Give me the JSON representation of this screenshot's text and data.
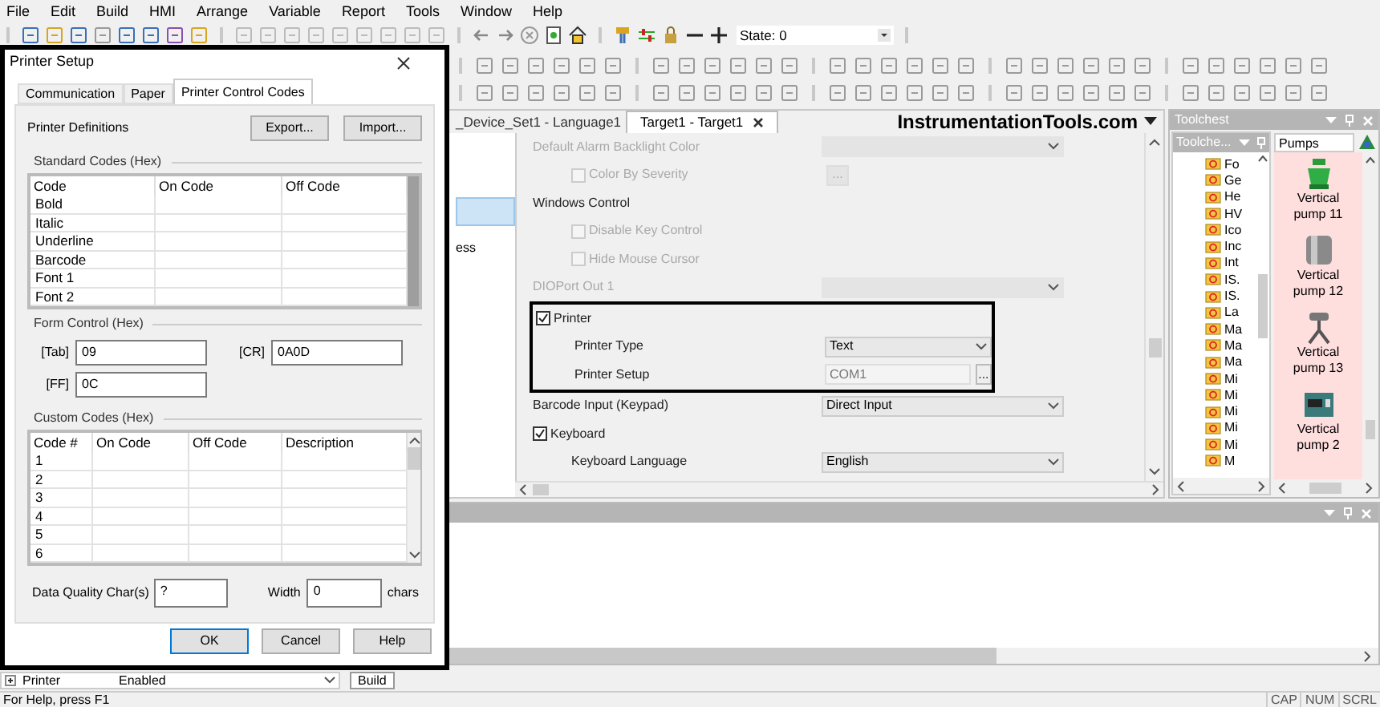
{
  "menu": [
    "File",
    "Edit",
    "Build",
    "HMI",
    "Arrange",
    "Variable",
    "Report",
    "Tools",
    "Window",
    "Help"
  ],
  "toolbar": {
    "state_label": "State: 0"
  },
  "document_tabs": [
    {
      "label": "_Device_Set1 - Language1",
      "selected": false
    },
    {
      "label": "Target1 - Target1",
      "selected": true
    }
  ],
  "site_label": "InstrumentationTools.com",
  "left_pane": {
    "text": "ess"
  },
  "properties": [
    {
      "kind": "dropdown",
      "label": "Default Alarm Backlight Color",
      "disabled": true,
      "indent": false
    },
    {
      "kind": "checkbox",
      "label": "Color By Severity",
      "checked": false,
      "disabled": true,
      "indent": true,
      "browse": "..."
    },
    {
      "kind": "heading",
      "label": "Windows Control"
    },
    {
      "kind": "checkbox",
      "label": "Disable Key Control",
      "checked": false,
      "disabled": true,
      "indent": true
    },
    {
      "kind": "checkbox",
      "label": "Hide Mouse Cursor",
      "checked": false,
      "disabled": true,
      "indent": true
    },
    {
      "kind": "dropdown",
      "label": "DIOPort Out 1",
      "disabled": true,
      "indent": false
    },
    {
      "kind": "group",
      "outlined": true,
      "children": [
        {
          "kind": "checkbox",
          "label": "Printer",
          "checked": true,
          "disabled": false,
          "indent": false
        },
        {
          "kind": "dropdown",
          "label": "Printer Type",
          "value": "Text",
          "disabled": false,
          "indent": true
        },
        {
          "kind": "field",
          "label": "Printer Setup",
          "value": "COM1",
          "indent": true,
          "browse": "..."
        }
      ]
    },
    {
      "kind": "dropdown",
      "label": "Barcode Input (Keypad)",
      "value": "Direct Input",
      "disabled": false,
      "indent": false
    },
    {
      "kind": "checkbox",
      "label": "Keyboard",
      "checked": true,
      "disabled": false,
      "indent": false
    },
    {
      "kind": "dropdown",
      "label": "Keyboard Language",
      "value": "English",
      "disabled": false,
      "indent": true
    }
  ],
  "toolchest": {
    "title": "Toolchest",
    "tree_title": "Toolche...",
    "tree_items": [
      "Fo",
      "Ge",
      "He",
      "HV",
      "Ico",
      "Inc",
      "Int",
      "IS.",
      "IS.",
      "La",
      "Ma",
      "Ma",
      "Ma",
      "Mi",
      "Mi",
      "Mi",
      "Mi",
      "Mi",
      "M"
    ],
    "library_tab": "Pumps",
    "library_items": [
      {
        "label": "Vertical pump 11",
        "kind": "green"
      },
      {
        "label": "Vertical pump 12",
        "kind": "drum"
      },
      {
        "label": "Vertical pump 13",
        "kind": "tripod"
      },
      {
        "label": "Vertical pump 2",
        "kind": "box"
      }
    ]
  },
  "bottom_row": {
    "name": "Printer",
    "value": "Enabled",
    "build_tab": "Build"
  },
  "status_bar": {
    "message": "For Help, press F1",
    "indicators": [
      "CAP",
      "NUM",
      "SCRL"
    ]
  },
  "dialog": {
    "title": "Printer Setup",
    "tabs": [
      {
        "label": "Communication",
        "selected": false
      },
      {
        "label": "Paper",
        "selected": false
      },
      {
        "label": "Printer Control Codes",
        "selected": true
      }
    ],
    "definitions_label": "Printer Definitions",
    "export_button": "Export...",
    "import_button": "Import...",
    "standard_title": "Standard Codes (Hex)",
    "standard_columns": [
      "Code",
      "On Code",
      "Off Code"
    ],
    "standard_rows": [
      "Bold",
      "Italic",
      "Underline",
      "Barcode",
      "Font 1",
      "Font 2"
    ],
    "form_title": "Form Control (Hex)",
    "form_fields": [
      {
        "label": "[Tab]",
        "value": "09"
      },
      {
        "label": "[CR]",
        "value": "0A0D"
      },
      {
        "label": "[FF]",
        "value": "0C"
      }
    ],
    "custom_title": "Custom Codes (Hex)",
    "custom_columns": [
      "Code #",
      "On Code",
      "Off Code",
      "Description"
    ],
    "custom_rows": [
      "1",
      "2",
      "3",
      "4",
      "5",
      "6"
    ],
    "quality_label": "Data Quality Char(s)",
    "quality_value": "?",
    "width_label": "Width",
    "width_value": "0",
    "width_unit": "chars",
    "buttons": [
      "OK",
      "Cancel",
      "Help"
    ]
  }
}
